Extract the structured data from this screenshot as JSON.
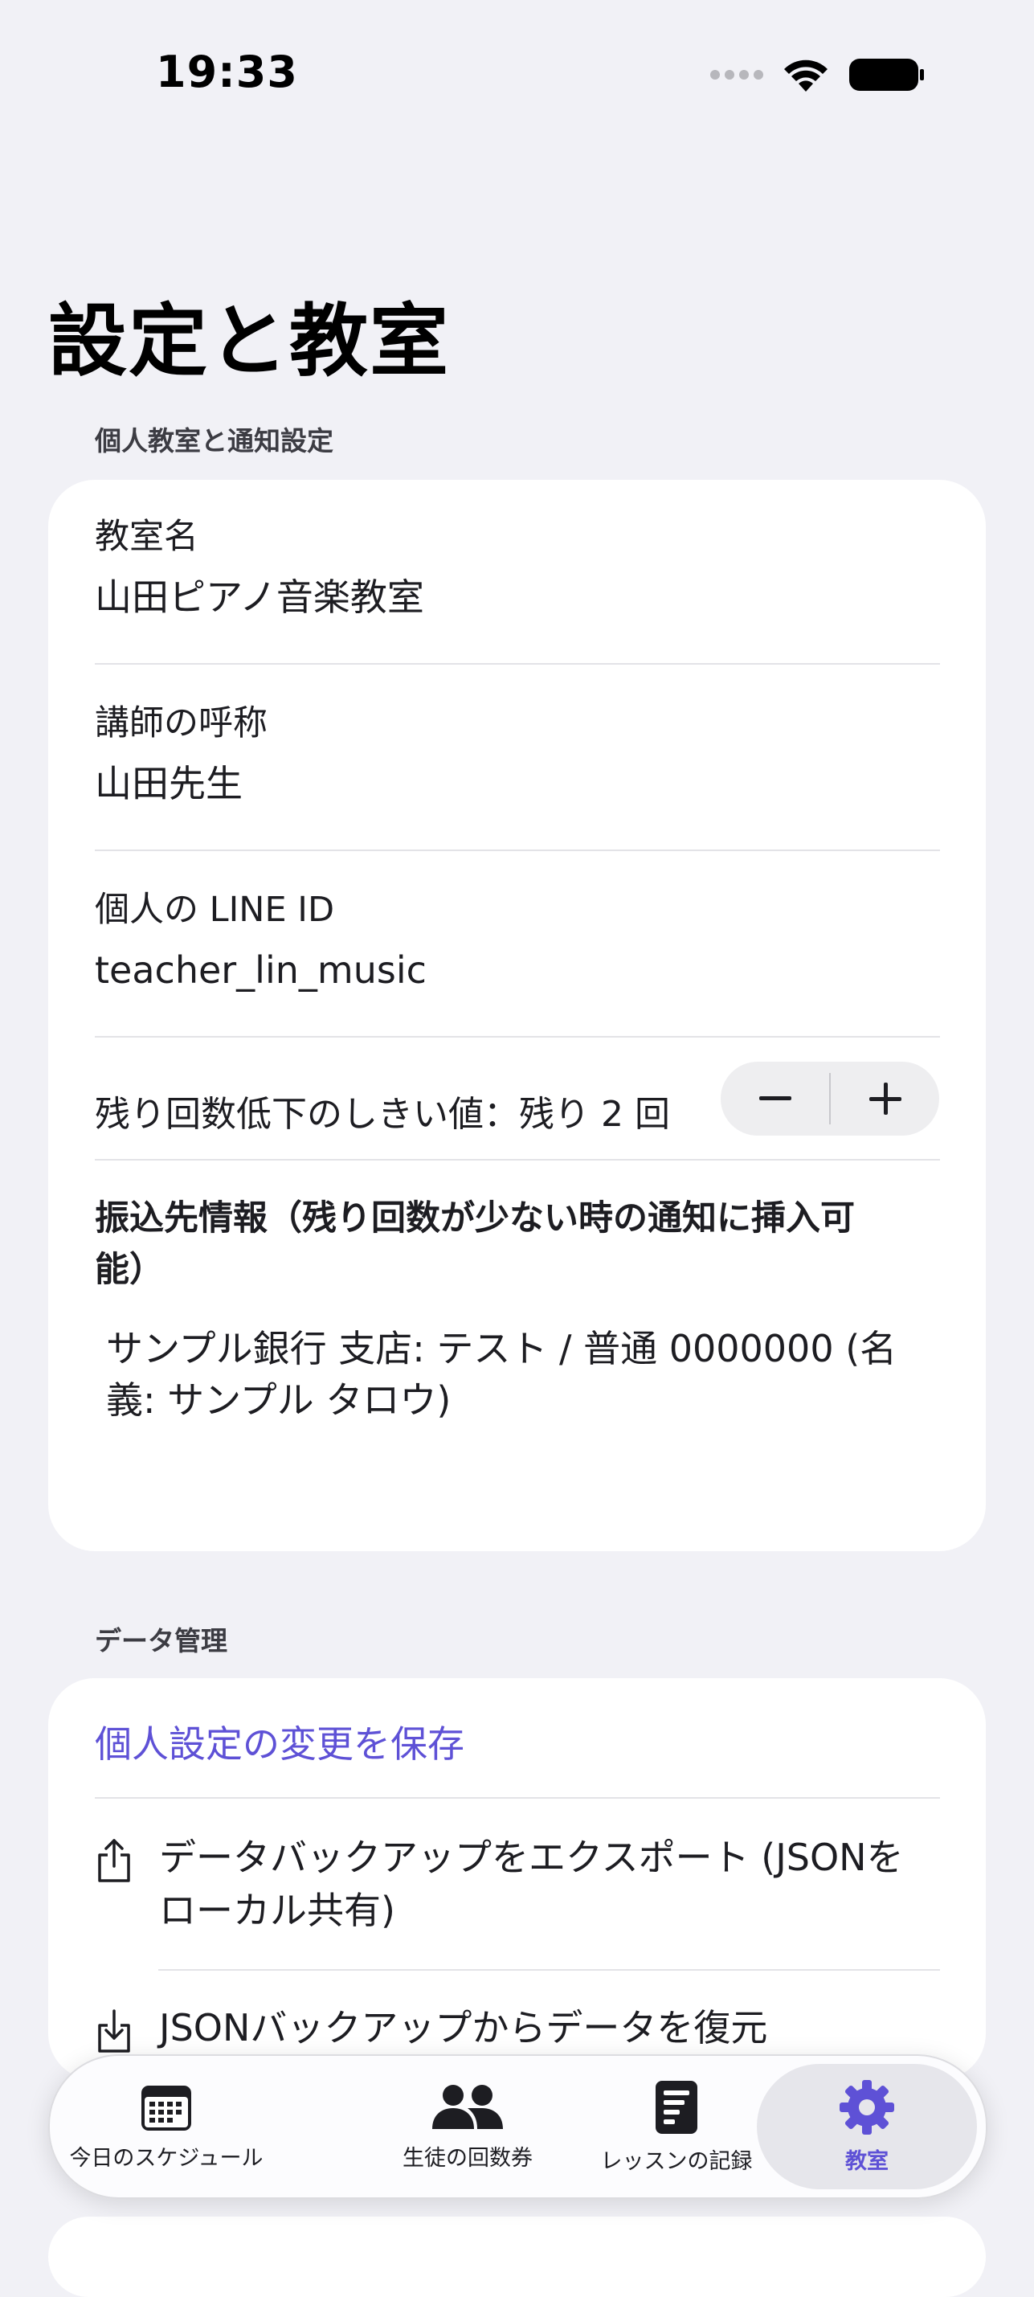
{
  "status_bar": {
    "time": "19:33"
  },
  "page": {
    "title": "設定と教室"
  },
  "personal_section": {
    "header": "個人教室と通知設定",
    "classroom_name_label": "教室名",
    "classroom_name_value": "山田ピアノ音楽教室",
    "teacher_title_label": "講師の呼称",
    "teacher_title_value": "山田先生",
    "line_id_label": "個人の LINE ID",
    "line_id_value": "teacher_lin_music",
    "threshold_label": "残り回数低下のしきい値：残り 2 回",
    "threshold_value": 2,
    "stepper_minus": "−",
    "stepper_plus": "+",
    "bank_info_title": "振込先情報（残り回数が少ない時の通知に挿入可能）",
    "bank_info_value": "サンプル銀行 支店: テスト / 普通 0000000 (名義: サンプル タロウ)"
  },
  "data_section": {
    "header": "データ管理",
    "save_label": "個人設定の変更を保存",
    "export_label": "データバックアップをエクスポート (JSONをローカル共有)",
    "export_icon": "share-icon",
    "restore_label": "JSONバックアップからデータを復元",
    "restore_icon": "import-icon"
  },
  "tab_bar": {
    "tabs": [
      {
        "label": "今日のスケジュール",
        "icon": "calendar-icon",
        "active": false
      },
      {
        "label": "生徒の回数券",
        "icon": "people-icon",
        "active": false
      },
      {
        "label": "レッスンの記録",
        "icon": "document-icon",
        "active": false
      },
      {
        "label": "教室",
        "icon": "gear-icon",
        "active": true
      }
    ]
  },
  "colors": {
    "accent": "#5E51D6",
    "background": "#F1F1F6",
    "card": "#FFFFFF"
  }
}
